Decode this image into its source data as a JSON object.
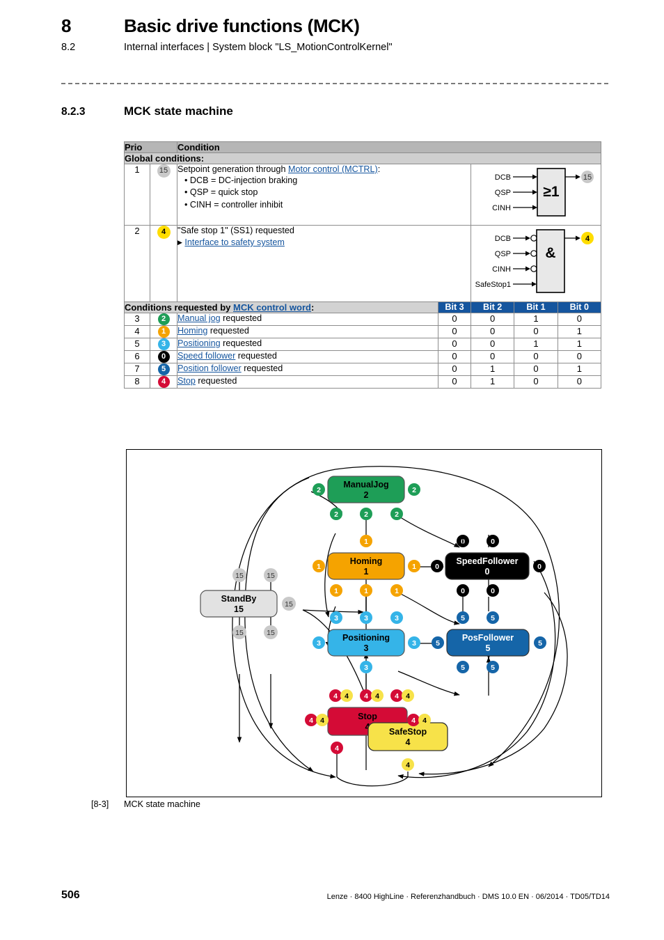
{
  "header": {
    "chapter_number": "8",
    "chapter_title": "Basic drive functions (MCK)",
    "section_number": "8.2",
    "section_title": "Internal interfaces | System block \"LS_MotionControlKernel\""
  },
  "section": {
    "number": "8.2.3",
    "title": "MCK state machine"
  },
  "table": {
    "headers": {
      "prio": "Prio",
      "condition": "Condition"
    },
    "global_row": "Global conditions:",
    "requested_row": {
      "prefix": "Conditions requested by ",
      "link": "MCK control word",
      "suffix": ":"
    },
    "bit_headers": [
      "Bit 3",
      "Bit 2",
      "Bit 1",
      "Bit 0"
    ],
    "global_conditions": [
      {
        "prio": "1",
        "badge": "15",
        "badge_color": "#c9c9c9",
        "text_prefix": "Setpoint generation through ",
        "link": "Motor control (MCTRL)",
        "text_suffix": ":",
        "bullets": [
          "• DCB = DC-injection braking",
          "• QSP = quick stop",
          "• CINH = controller inhibit"
        ],
        "gate": {
          "symbol": "≥1",
          "inputs": [
            "DCB",
            "QSP",
            "CINH"
          ],
          "inverted": false,
          "output_badge": "15",
          "output_color": "#c9c9c9"
        }
      },
      {
        "prio": "2",
        "badge": "4",
        "badge_color": "#ffdd00",
        "text_prefix": "\"Safe stop 1\" (SS1) requested",
        "link": "Interface to safety system",
        "text_suffix": "",
        "bullets": [],
        "gate": {
          "symbol": "&",
          "inputs": [
            "DCB",
            "QSP",
            "CINH",
            "SafeStop1"
          ],
          "inverted": true,
          "output_badge": "4",
          "output_color": "#ffdd00"
        }
      }
    ],
    "rows": [
      {
        "prio": "3",
        "badge": "2",
        "badge_color": "#1e9e57",
        "link": "Manual jog",
        "rest": " requested",
        "bits": [
          "0",
          "0",
          "1",
          "0"
        ]
      },
      {
        "prio": "4",
        "badge": "1",
        "badge_color": "#f5a300",
        "link": "Homing",
        "rest": " requested",
        "bits": [
          "0",
          "0",
          "0",
          "1"
        ]
      },
      {
        "prio": "5",
        "badge": "3",
        "badge_color": "#35b4e8",
        "link": "Positioning",
        "rest": " requested",
        "bits": [
          "0",
          "0",
          "1",
          "1"
        ]
      },
      {
        "prio": "6",
        "badge": "0",
        "badge_color": "#000000",
        "link": "Speed follower",
        "rest": " requested",
        "bits": [
          "0",
          "0",
          "0",
          "0"
        ]
      },
      {
        "prio": "7",
        "badge": "5",
        "badge_color": "#1565a8",
        "link": "Position follower",
        "rest": " requested",
        "bits": [
          "0",
          "1",
          "0",
          "1"
        ]
      },
      {
        "prio": "8",
        "badge": "4",
        "badge_color": "#d40b36",
        "link": "Stop",
        "rest": " requested",
        "bits": [
          "0",
          "1",
          "0",
          "0"
        ]
      }
    ]
  },
  "diagram": {
    "nodes": [
      {
        "id": "manualjog",
        "label": "ManualJog",
        "state": "2",
        "fill": "#1e9e57",
        "text": "#000000"
      },
      {
        "id": "homing",
        "label": "Homing",
        "state": "1",
        "fill": "#f5a300",
        "text": "#000000"
      },
      {
        "id": "speedfollower",
        "label": "SpeedFollower",
        "state": "0",
        "fill": "#000000",
        "text": "#ffffff"
      },
      {
        "id": "standby",
        "label": "StandBy",
        "state": "15",
        "fill": "#e2e2e2",
        "text": "#000000"
      },
      {
        "id": "positioning",
        "label": "Positioning",
        "state": "3",
        "fill": "#35b4e8",
        "text": "#000000"
      },
      {
        "id": "posfollower",
        "label": "PosFollower",
        "state": "5",
        "fill": "#1565a8",
        "text": "#ffffff"
      },
      {
        "id": "stop",
        "label": "Stop",
        "state": "4",
        "fill": "#d40b36",
        "text": "#000000"
      },
      {
        "id": "safestop",
        "label": "SafeStop",
        "state": "4",
        "fill": "#f7e249",
        "text": "#000000"
      }
    ],
    "transition_labels": [
      "0",
      "1",
      "2",
      "3",
      "4",
      "5",
      "15"
    ]
  },
  "caption": {
    "number": "[8-3]",
    "text": "MCK state machine"
  },
  "footer": {
    "page_number": "506",
    "text": "Lenze · 8400 HighLine · Referenzhandbuch · DMS 10.0 EN · 06/2014 · TD05/TD14"
  }
}
